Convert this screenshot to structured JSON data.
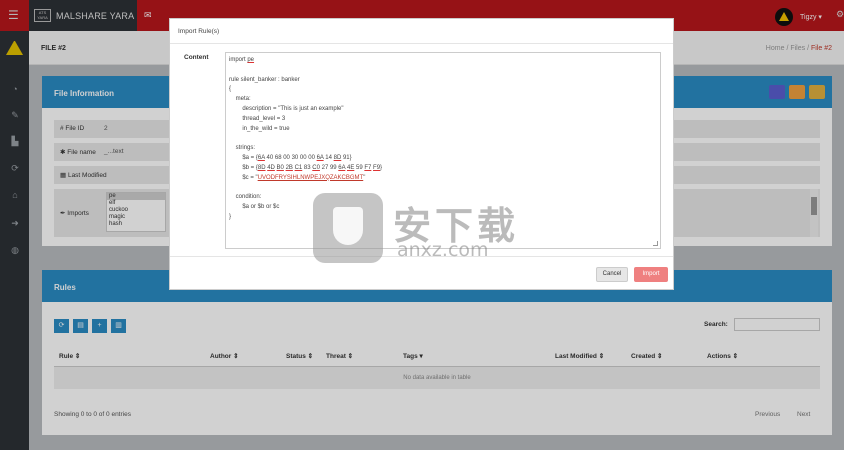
{
  "topbar": {
    "brand_logo_text": "ATS\nYARA",
    "brand_title": "MALSHARE YARA",
    "user_name": "Tigzy ▾",
    "icons": [
      "menu-icon",
      "mail-icon",
      "gear-icon"
    ]
  },
  "sidebar": {
    "icons": [
      "dashboard-icon",
      "pencil-icon",
      "chart-icon",
      "refresh-icon",
      "home-icon",
      "arrow-icon",
      "globe-icon"
    ]
  },
  "page": {
    "title": "FILE #2",
    "breadcrumb": [
      "Home",
      "/",
      "Files",
      "/",
      "File #2"
    ]
  },
  "file_info": {
    "header": "File Information",
    "tool_colors": [
      "#5b5fd0",
      "#f0a040",
      "#e0b040"
    ],
    "fields": [
      {
        "label": "File ID",
        "value": "2"
      },
      {
        "label": "File name",
        "value": "_...text"
      },
      {
        "label": "Last Modified",
        "value": ""
      }
    ],
    "imports_label": "Imports",
    "imports": [
      "pe",
      "elf",
      "cuckoo",
      "magic",
      "hash"
    ]
  },
  "rules": {
    "header": "Rules",
    "buttons": [
      "⟳",
      "▤",
      "+",
      "▥"
    ],
    "search_label": "Search:",
    "columns": [
      "Rule ⇕",
      "Author ⇕",
      "Status ⇕",
      "Threat ⇕",
      "Tags ▾",
      "Last Modified ⇕",
      "Created ⇕",
      "Actions ⇕"
    ],
    "empty_text": "No data available in table",
    "showing": "Showing 0 to 0 of 0 entries",
    "prev": "Previous",
    "next": "Next"
  },
  "modal": {
    "title": "Import Rule(s)",
    "content_label": "Content",
    "cancel": "Cancel",
    "import": "Import"
  },
  "watermark": {
    "cn": "安下载",
    "en": "anxz.com"
  }
}
